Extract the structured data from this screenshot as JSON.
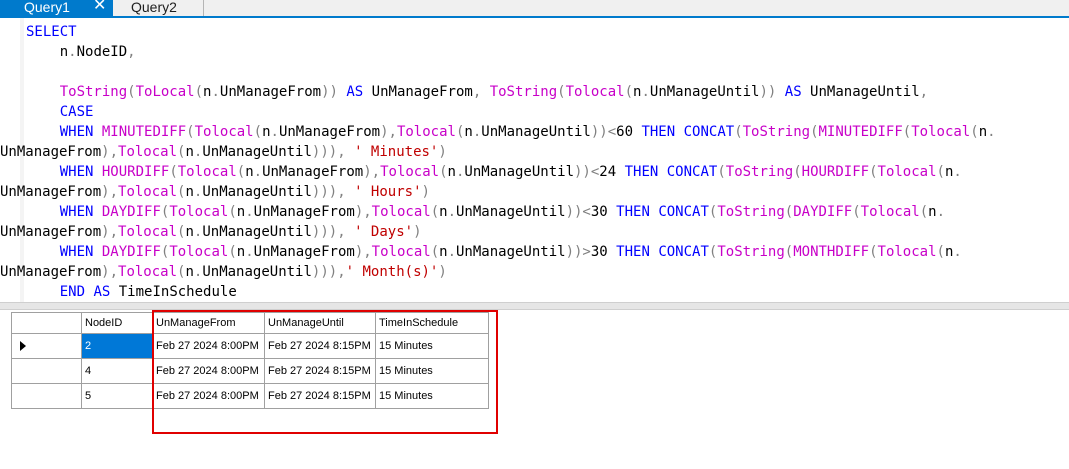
{
  "tabs": [
    {
      "label": "Query1",
      "active": true,
      "close_glyph": "✕"
    },
    {
      "label": "Query2",
      "active": false
    }
  ],
  "colors": {
    "accent": "#007acc",
    "keyword": "#0000ff",
    "function": "#c800c8",
    "string": "#c00000",
    "operator": "#808080",
    "selected_cell": "#0078d7",
    "highlight_box": "#e00000"
  },
  "code_lines": [
    {
      "wrap": false,
      "tokens": [
        {
          "t": "SELECT",
          "c": "kw"
        }
      ]
    },
    {
      "wrap": false,
      "tokens": [
        {
          "t": "    n",
          "c": ""
        },
        {
          "t": ".",
          "c": "op"
        },
        {
          "t": "NodeID",
          "c": ""
        },
        {
          "t": ",",
          "c": "op"
        }
      ]
    },
    {
      "wrap": false,
      "tokens": []
    },
    {
      "wrap": false,
      "tokens": [
        {
          "t": "    ",
          "c": ""
        },
        {
          "t": "ToString",
          "c": "fn"
        },
        {
          "t": "(",
          "c": "op"
        },
        {
          "t": "ToLocal",
          "c": "fn"
        },
        {
          "t": "(",
          "c": "op"
        },
        {
          "t": "n",
          "c": ""
        },
        {
          "t": ".",
          "c": "op"
        },
        {
          "t": "UnManageFrom",
          "c": ""
        },
        {
          "t": "))",
          "c": "op"
        },
        {
          "t": " ",
          "c": ""
        },
        {
          "t": "AS",
          "c": "kw"
        },
        {
          "t": " UnManageFrom",
          "c": ""
        },
        {
          "t": ",",
          "c": "op"
        },
        {
          "t": " ",
          "c": ""
        },
        {
          "t": "ToString",
          "c": "fn"
        },
        {
          "t": "(",
          "c": "op"
        },
        {
          "t": "Tolocal",
          "c": "fn"
        },
        {
          "t": "(",
          "c": "op"
        },
        {
          "t": "n",
          "c": ""
        },
        {
          "t": ".",
          "c": "op"
        },
        {
          "t": "UnManageUntil",
          "c": ""
        },
        {
          "t": "))",
          "c": "op"
        },
        {
          "t": " ",
          "c": ""
        },
        {
          "t": "AS",
          "c": "kw"
        },
        {
          "t": " UnManageUntil",
          "c": ""
        },
        {
          "t": ",",
          "c": "op"
        }
      ]
    },
    {
      "wrap": false,
      "tokens": [
        {
          "t": "    ",
          "c": ""
        },
        {
          "t": "CASE",
          "c": "kw"
        }
      ]
    },
    {
      "wrap": false,
      "tokens": [
        {
          "t": "    ",
          "c": ""
        },
        {
          "t": "WHEN",
          "c": "kw"
        },
        {
          "t": " ",
          "c": ""
        },
        {
          "t": "MINUTEDIFF",
          "c": "fn"
        },
        {
          "t": "(",
          "c": "op"
        },
        {
          "t": "Tolocal",
          "c": "fn"
        },
        {
          "t": "(",
          "c": "op"
        },
        {
          "t": "n",
          "c": ""
        },
        {
          "t": ".",
          "c": "op"
        },
        {
          "t": "UnManageFrom",
          "c": ""
        },
        {
          "t": "),",
          "c": "op"
        },
        {
          "t": "Tolocal",
          "c": "fn"
        },
        {
          "t": "(",
          "c": "op"
        },
        {
          "t": "n",
          "c": ""
        },
        {
          "t": ".",
          "c": "op"
        },
        {
          "t": "UnManageUntil",
          "c": ""
        },
        {
          "t": "))<",
          "c": "op"
        },
        {
          "t": "60",
          "c": "num"
        },
        {
          "t": " ",
          "c": ""
        },
        {
          "t": "THEN",
          "c": "kw"
        },
        {
          "t": " ",
          "c": ""
        },
        {
          "t": "CONCAT",
          "c": "kw"
        },
        {
          "t": "(",
          "c": "op"
        },
        {
          "t": "ToString",
          "c": "fn"
        },
        {
          "t": "(",
          "c": "op"
        },
        {
          "t": "MINUTEDIFF",
          "c": "fn"
        },
        {
          "t": "(",
          "c": "op"
        },
        {
          "t": "Tolocal",
          "c": "fn"
        },
        {
          "t": "(",
          "c": "op"
        },
        {
          "t": "n",
          "c": ""
        },
        {
          "t": ".",
          "c": "op"
        }
      ]
    },
    {
      "wrap": true,
      "tokens": [
        {
          "t": "UnManageFrom",
          "c": ""
        },
        {
          "t": "),",
          "c": "op"
        },
        {
          "t": "Tolocal",
          "c": "fn"
        },
        {
          "t": "(",
          "c": "op"
        },
        {
          "t": "n",
          "c": ""
        },
        {
          "t": ".",
          "c": "op"
        },
        {
          "t": "UnManageUntil",
          "c": ""
        },
        {
          "t": "))),",
          "c": "op"
        },
        {
          "t": " ",
          "c": ""
        },
        {
          "t": "' Minutes'",
          "c": "str"
        },
        {
          "t": ")",
          "c": "op"
        }
      ]
    },
    {
      "wrap": false,
      "tokens": [
        {
          "t": "    ",
          "c": ""
        },
        {
          "t": "WHEN",
          "c": "kw"
        },
        {
          "t": " ",
          "c": ""
        },
        {
          "t": "HOURDIFF",
          "c": "fn"
        },
        {
          "t": "(",
          "c": "op"
        },
        {
          "t": "Tolocal",
          "c": "fn"
        },
        {
          "t": "(",
          "c": "op"
        },
        {
          "t": "n",
          "c": ""
        },
        {
          "t": ".",
          "c": "op"
        },
        {
          "t": "UnManageFrom",
          "c": ""
        },
        {
          "t": "),",
          "c": "op"
        },
        {
          "t": "Tolocal",
          "c": "fn"
        },
        {
          "t": "(",
          "c": "op"
        },
        {
          "t": "n",
          "c": ""
        },
        {
          "t": ".",
          "c": "op"
        },
        {
          "t": "UnManageUntil",
          "c": ""
        },
        {
          "t": "))<",
          "c": "op"
        },
        {
          "t": "24",
          "c": "num"
        },
        {
          "t": " ",
          "c": ""
        },
        {
          "t": "THEN",
          "c": "kw"
        },
        {
          "t": " ",
          "c": ""
        },
        {
          "t": "CONCAT",
          "c": "kw"
        },
        {
          "t": "(",
          "c": "op"
        },
        {
          "t": "ToString",
          "c": "fn"
        },
        {
          "t": "(",
          "c": "op"
        },
        {
          "t": "HOURDIFF",
          "c": "fn"
        },
        {
          "t": "(",
          "c": "op"
        },
        {
          "t": "Tolocal",
          "c": "fn"
        },
        {
          "t": "(",
          "c": "op"
        },
        {
          "t": "n",
          "c": ""
        },
        {
          "t": ".",
          "c": "op"
        }
      ]
    },
    {
      "wrap": true,
      "tokens": [
        {
          "t": "UnManageFrom",
          "c": ""
        },
        {
          "t": "),",
          "c": "op"
        },
        {
          "t": "Tolocal",
          "c": "fn"
        },
        {
          "t": "(",
          "c": "op"
        },
        {
          "t": "n",
          "c": ""
        },
        {
          "t": ".",
          "c": "op"
        },
        {
          "t": "UnManageUntil",
          "c": ""
        },
        {
          "t": "))),",
          "c": "op"
        },
        {
          "t": " ",
          "c": ""
        },
        {
          "t": "' Hours'",
          "c": "str"
        },
        {
          "t": ")",
          "c": "op"
        }
      ]
    },
    {
      "wrap": false,
      "tokens": [
        {
          "t": "    ",
          "c": ""
        },
        {
          "t": "WHEN",
          "c": "kw"
        },
        {
          "t": " ",
          "c": ""
        },
        {
          "t": "DAYDIFF",
          "c": "fn"
        },
        {
          "t": "(",
          "c": "op"
        },
        {
          "t": "Tolocal",
          "c": "fn"
        },
        {
          "t": "(",
          "c": "op"
        },
        {
          "t": "n",
          "c": ""
        },
        {
          "t": ".",
          "c": "op"
        },
        {
          "t": "UnManageFrom",
          "c": ""
        },
        {
          "t": "),",
          "c": "op"
        },
        {
          "t": "Tolocal",
          "c": "fn"
        },
        {
          "t": "(",
          "c": "op"
        },
        {
          "t": "n",
          "c": ""
        },
        {
          "t": ".",
          "c": "op"
        },
        {
          "t": "UnManageUntil",
          "c": ""
        },
        {
          "t": "))<",
          "c": "op"
        },
        {
          "t": "30",
          "c": "num"
        },
        {
          "t": " ",
          "c": ""
        },
        {
          "t": "THEN",
          "c": "kw"
        },
        {
          "t": " ",
          "c": ""
        },
        {
          "t": "CONCAT",
          "c": "kw"
        },
        {
          "t": "(",
          "c": "op"
        },
        {
          "t": "ToString",
          "c": "fn"
        },
        {
          "t": "(",
          "c": "op"
        },
        {
          "t": "DAYDIFF",
          "c": "fn"
        },
        {
          "t": "(",
          "c": "op"
        },
        {
          "t": "Tolocal",
          "c": "fn"
        },
        {
          "t": "(",
          "c": "op"
        },
        {
          "t": "n",
          "c": ""
        },
        {
          "t": ".",
          "c": "op"
        }
      ]
    },
    {
      "wrap": true,
      "tokens": [
        {
          "t": "UnManageFrom",
          "c": ""
        },
        {
          "t": "),",
          "c": "op"
        },
        {
          "t": "Tolocal",
          "c": "fn"
        },
        {
          "t": "(",
          "c": "op"
        },
        {
          "t": "n",
          "c": ""
        },
        {
          "t": ".",
          "c": "op"
        },
        {
          "t": "UnManageUntil",
          "c": ""
        },
        {
          "t": "))),",
          "c": "op"
        },
        {
          "t": " ",
          "c": ""
        },
        {
          "t": "' Days'",
          "c": "str"
        },
        {
          "t": ")",
          "c": "op"
        }
      ]
    },
    {
      "wrap": false,
      "tokens": [
        {
          "t": "    ",
          "c": ""
        },
        {
          "t": "WHEN",
          "c": "kw"
        },
        {
          "t": " ",
          "c": ""
        },
        {
          "t": "DAYDIFF",
          "c": "fn"
        },
        {
          "t": "(",
          "c": "op"
        },
        {
          "t": "Tolocal",
          "c": "fn"
        },
        {
          "t": "(",
          "c": "op"
        },
        {
          "t": "n",
          "c": ""
        },
        {
          "t": ".",
          "c": "op"
        },
        {
          "t": "UnManageFrom",
          "c": ""
        },
        {
          "t": "),",
          "c": "op"
        },
        {
          "t": "Tolocal",
          "c": "fn"
        },
        {
          "t": "(",
          "c": "op"
        },
        {
          "t": "n",
          "c": ""
        },
        {
          "t": ".",
          "c": "op"
        },
        {
          "t": "UnManageUntil",
          "c": ""
        },
        {
          "t": "))>",
          "c": "op"
        },
        {
          "t": "30",
          "c": "num"
        },
        {
          "t": " ",
          "c": ""
        },
        {
          "t": "THEN",
          "c": "kw"
        },
        {
          "t": " ",
          "c": ""
        },
        {
          "t": "CONCAT",
          "c": "kw"
        },
        {
          "t": "(",
          "c": "op"
        },
        {
          "t": "ToString",
          "c": "fn"
        },
        {
          "t": "(",
          "c": "op"
        },
        {
          "t": "MONTHDIFF",
          "c": "fn"
        },
        {
          "t": "(",
          "c": "op"
        },
        {
          "t": "Tolocal",
          "c": "fn"
        },
        {
          "t": "(",
          "c": "op"
        },
        {
          "t": "n",
          "c": ""
        },
        {
          "t": ".",
          "c": "op"
        }
      ]
    },
    {
      "wrap": true,
      "tokens": [
        {
          "t": "UnManageFrom",
          "c": ""
        },
        {
          "t": "),",
          "c": "op"
        },
        {
          "t": "Tolocal",
          "c": "fn"
        },
        {
          "t": "(",
          "c": "op"
        },
        {
          "t": "n",
          "c": ""
        },
        {
          "t": ".",
          "c": "op"
        },
        {
          "t": "UnManageUntil",
          "c": ""
        },
        {
          "t": "))),",
          "c": "op"
        },
        {
          "t": "' Month(s)'",
          "c": "str"
        },
        {
          "t": ")",
          "c": "op"
        }
      ]
    },
    {
      "wrap": false,
      "tokens": [
        {
          "t": "    ",
          "c": ""
        },
        {
          "t": "END",
          "c": "kw"
        },
        {
          "t": " ",
          "c": ""
        },
        {
          "t": "AS",
          "c": "kw"
        },
        {
          "t": " TimeInSchedule",
          "c": ""
        }
      ]
    }
  ],
  "results": {
    "columns": [
      "NodeID",
      "UnManageFrom",
      "UnManageUntil",
      "TimeInSchedule"
    ],
    "rows": [
      {
        "current": true,
        "cells": [
          "2",
          "Feb 27 2024  8:00PM",
          "Feb 27 2024  8:15PM",
          "15 Minutes"
        ]
      },
      {
        "current": false,
        "cells": [
          "4",
          "Feb 27 2024  8:00PM",
          "Feb 27 2024  8:15PM",
          "15 Minutes"
        ]
      },
      {
        "current": false,
        "cells": [
          "5",
          "Feb 27 2024  8:00PM",
          "Feb 27 2024  8:15PM",
          "15 Minutes"
        ]
      }
    ],
    "selected_cell": {
      "row": 0,
      "column": "NodeID"
    }
  },
  "icons": {
    "current_row": "triangle-right-icon",
    "tab_close": "close-icon"
  }
}
